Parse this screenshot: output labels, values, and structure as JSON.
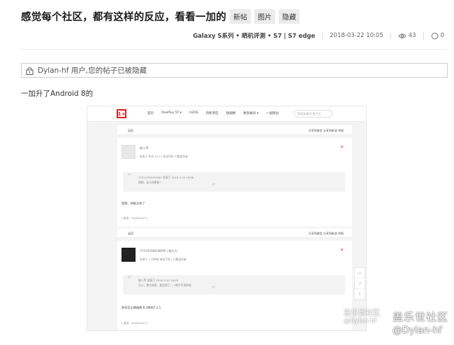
{
  "post": {
    "title": "感觉每个社区，都有这样的反应，看看一加的",
    "tags": [
      "新帖",
      "图片",
      "隐藏"
    ],
    "category": "Galaxy S系列 • 晒机评测 • S7 | S7 edge",
    "date": "2018-03-22 10:05",
    "views": "43",
    "replies": "0",
    "notice": "Dylan-hf 用户,您的帖子已被隐藏",
    "body": "一加升了Android 8的"
  },
  "screenshot": {
    "logo": "1+",
    "nav": [
      "首页",
      "OnePlus 5T ▾",
      "H2OS",
      "玩机专区",
      "短视频",
      "更多板块 ▾",
      "一加周边"
    ],
    "search_placeholder": "搜索关键字/用户名",
    "bar_back": "返回",
    "bar_actions": "分享到微信   分享到新浪   举报",
    "post1": {
      "user": "路人甲",
      "meta": "发表于 昨天 15:27   来自手机   只看该作者",
      "quote_line1": "1751470402458​1 发表于 2018-3-20 16:08",
      "quote_line2": "刚刷，这么快更新！",
      "text": "是啊，掉电太快了",
      "from": "[ 来自：OnePlus5T ]"
    },
    "post2": {
      "user": "1751920800669​9   |   路光大",
      "meta": "发表于 2 分钟前   来自手机   |   只看该作者",
      "quote_line1": "路人甲 发表于 2018-3-20 16:08",
      "quote_line2": "可以，把它刷再，要回到了，一眼不不用的电",
      "text": "那你怎么降级啊  8.1降到7.1.1",
      "from": "[ 来自：OnePlus5T ]"
    }
  },
  "watermark": {
    "small_line1": "盖乐世社区",
    "small_line2": "@Dylan-hf",
    "big_line1": "盖乐世社区",
    "big_line2": "@Dylan-hf"
  }
}
